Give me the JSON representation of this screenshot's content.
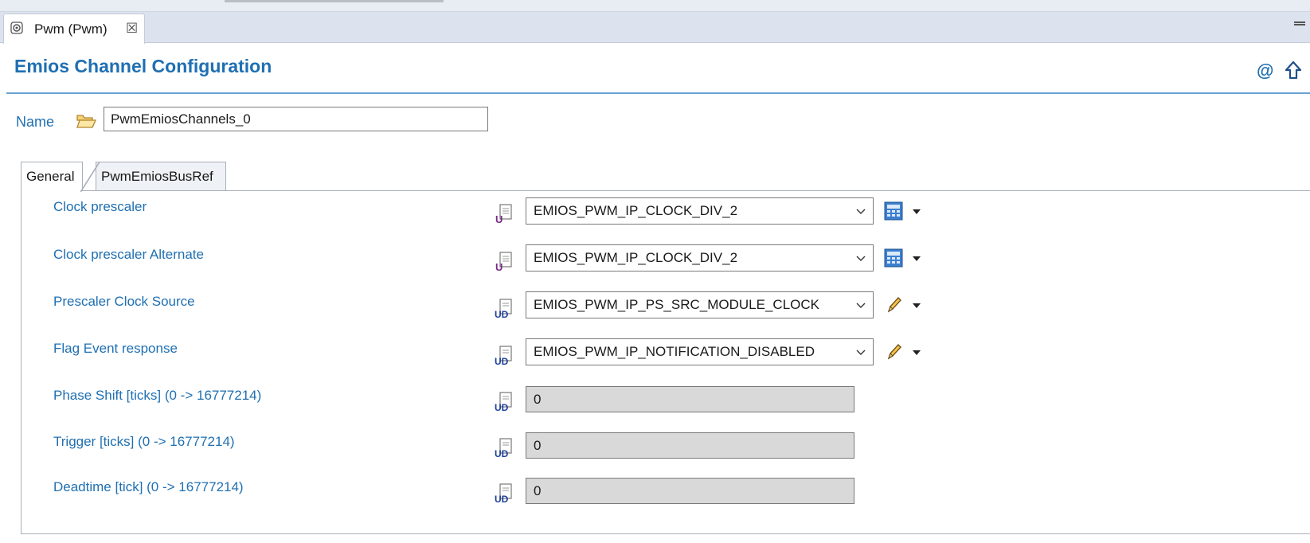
{
  "editor": {
    "tab_label": "Pwm (Pwm)",
    "tab_close": "☒"
  },
  "form": {
    "title": "Emios Channel Configuration",
    "at_symbol": "@",
    "name_label": "Name",
    "name_value": "PwmEmiosChannels_0"
  },
  "subtabs": [
    "General",
    "PwmEmiosBusRef"
  ],
  "rows": [
    {
      "label": "Clock prescaler",
      "value": "EMIOS_PWM_IP_CLOCK_DIV_2",
      "kind": "enum",
      "icon": "param-config-icon",
      "action_icon": "calculator-icon"
    },
    {
      "label": "Clock prescaler Alternate",
      "value": "EMIOS_PWM_IP_CLOCK_DIV_2",
      "kind": "enum",
      "icon": "param-config-icon",
      "action_icon": "calculator-icon"
    },
    {
      "label": "Prescaler Clock Source",
      "value": "EMIOS_PWM_IP_PS_SRC_MODULE_CLOCK",
      "kind": "enum",
      "icon": "param-userdef-icon",
      "action_icon": "pencil-icon"
    },
    {
      "label": "Flag Event response",
      "value": "EMIOS_PWM_IP_NOTIFICATION_DISABLED",
      "kind": "enum",
      "icon": "param-userdef-icon",
      "action_icon": "pencil-icon"
    },
    {
      "label": "Phase Shift [ticks] (0 -> 16777214)",
      "value": "0",
      "kind": "number",
      "icon": "param-userdef-icon"
    },
    {
      "label": "Trigger [ticks] (0 -> 16777214)",
      "value": "0",
      "kind": "number",
      "icon": "param-userdef-icon"
    },
    {
      "label": "Deadtime [tick] (0 -> 16777214)",
      "value": "0",
      "kind": "number",
      "icon": "param-userdef-icon"
    }
  ],
  "colors": {
    "accent": "#1f6fb2",
    "readonly_field": "#d9d9d9",
    "tabbar": "#dce3ee"
  }
}
